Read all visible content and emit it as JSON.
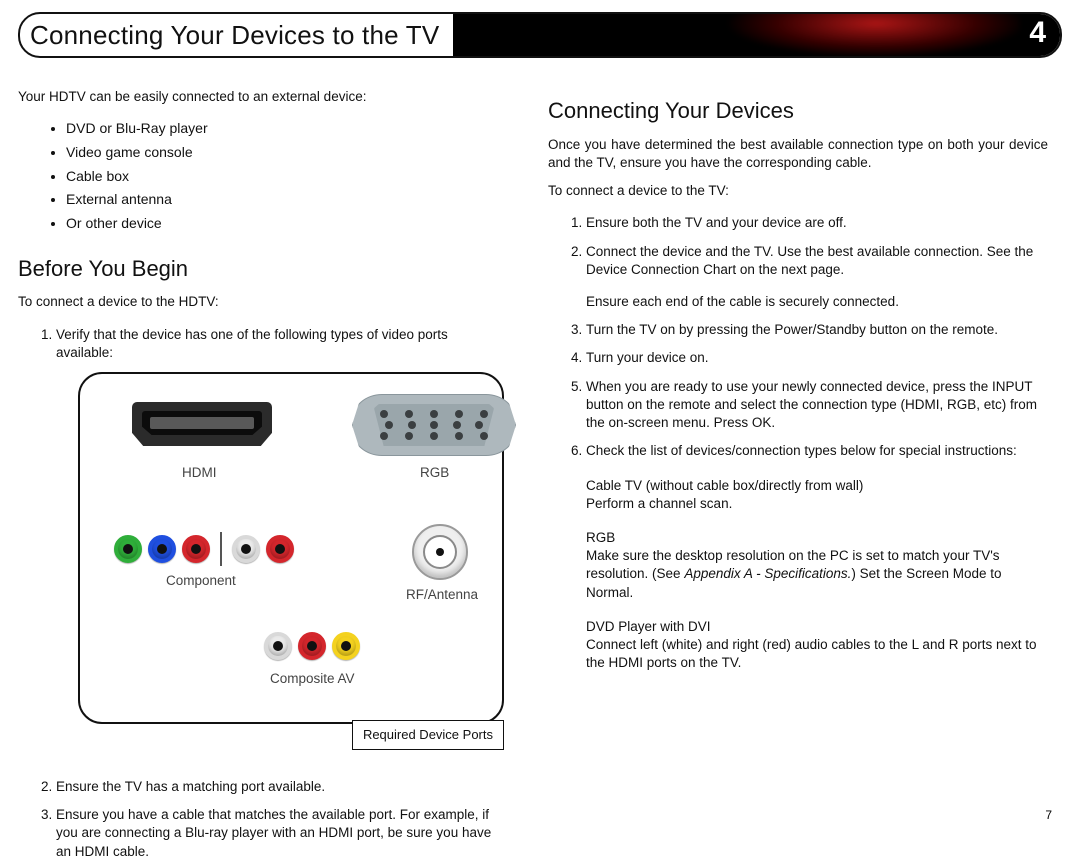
{
  "header": {
    "title": "Connecting Your Devices to the TV",
    "chapter": "4"
  },
  "left": {
    "intro": "Your HDTV can be easily connected to an external device:",
    "devices": [
      "DVD or Blu-Ray player",
      "Video game console",
      "Cable box",
      "External antenna",
      "Or other device"
    ],
    "before_h": "Before You Begin",
    "before_sub": "To connect a device to the HDTV:",
    "step1": "Verify that the device has one of the following types of video ports available:",
    "ports": {
      "hdmi": "HDMI",
      "rgb": "RGB",
      "component": "Component",
      "rf": "RF/Antenna",
      "composite": "Composite AV",
      "caption": "Required Device Ports"
    },
    "step2": "Ensure the TV has a matching port available.",
    "step3": "Ensure you have a cable that matches the available port. For example, if you are connecting a Blu-ray player with an HDMI port, be sure you have an HDMI cable."
  },
  "right": {
    "h": "Connecting Your Devices",
    "p1": "Once you have determined the best available connection type on both your device and the TV, ensure you have the corresponding cable.",
    "sub": "To connect a device to the TV:",
    "s1": "Ensure both the TV and your device are off.",
    "s2a": "Connect the device and the TV. Use the best available connection. See the Device Connection Chart on the next page.",
    "s2b": "Ensure each end of the cable is securely connected.",
    "s3": "Turn the TV on by pressing the Power/Standby button on the remote.",
    "s4": "Turn your device on.",
    "s5": "When you are ready to use your newly connected device, press the INPUT button on the remote and select the connection type (HDMI, RGB, etc) from the on-screen menu. Press OK.",
    "s6": "Check the list of devices/connection types below for special instructions:",
    "b1t": "Cable TV (without cable box/directly from wall)",
    "b1b": "Perform a channel scan.",
    "b2t": "RGB",
    "b2b1": "Make sure the desktop resolution on the PC is set to match your TV's resolution. (See ",
    "b2i": "Appendix A - Specifications.",
    "b2b2": ") Set the Screen Mode to Normal.",
    "b3t": "DVD Player with DVI",
    "b3b": "Connect left (white) and right (red) audio cables to the L and R ports next to the HDMI ports on the TV."
  },
  "page_number": "7"
}
